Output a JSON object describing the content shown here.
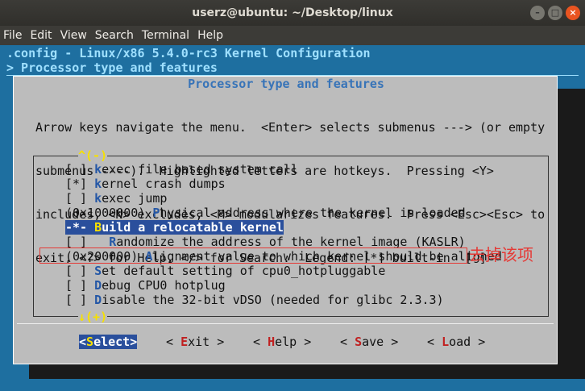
{
  "window": {
    "title": "userz@ubuntu: ~/Desktop/linux"
  },
  "menubar": [
    "File",
    "Edit",
    "View",
    "Search",
    "Terminal",
    "Help"
  ],
  "header": {
    "line1": ".config - Linux/x86 5.4.0-rc3 Kernel Configuration",
    "line2": "> Processor type and features"
  },
  "dialog": {
    "title": "Processor type and features",
    "help": [
      "Arrow keys navigate the menu.  <Enter> selects submenus ---> (or empty",
      "submenus ----).  Highlighted letters are hotkeys.  Pressing <Y>",
      "includes, <N> excludes, <M> modularizes features.  Press <Esc><Esc> to",
      "exit, <?> for Help, </> for Search.  Legend: [*] built-in  [ ]"
    ],
    "scroll_up": "^(-)",
    "scroll_down": "↓(+)",
    "items": [
      {
        "pre": "[ ] ",
        "hot": "k",
        "rest": "exec file based system call"
      },
      {
        "pre": "[*] ",
        "hot": "k",
        "rest": "ernel crash dumps"
      },
      {
        "pre": "[ ] ",
        "hot": "k",
        "rest": "exec jump"
      },
      {
        "pre": "(0x1000000) ",
        "hot": "P",
        "rest": "hysical address where the kernel is loaded"
      },
      {
        "pre": "-*- ",
        "hot": "B",
        "rest": "uild a relocatable kernel"
      },
      {
        "pre": "[ ]   ",
        "hot": "R",
        "rest": "andomize the address of the kernel image (KASLR)"
      },
      {
        "pre": "(0x200000) ",
        "hot": "A",
        "rest": "lignment value to which kernel should be aligned"
      },
      {
        "pre": "[ ] ",
        "hot": "S",
        "rest": "et default setting of cpu0_hotpluggable"
      },
      {
        "pre": "[ ] ",
        "hot": "D",
        "rest": "ebug CPU0 hotplug"
      },
      {
        "pre": "[ ] ",
        "hot": "D",
        "rest": "isable the 32-bit vDSO (needed for glibc 2.3.3)"
      }
    ],
    "buttons": [
      {
        "pre": "<",
        "hot": "S",
        "rest": "elect>"
      },
      {
        "pre": "< ",
        "hot": "E",
        "rest": "xit >"
      },
      {
        "pre": "< ",
        "hot": "H",
        "rest": "elp >"
      },
      {
        "pre": "< ",
        "hot": "S",
        "rest": "ave >"
      },
      {
        "pre": "< ",
        "hot": "L",
        "rest": "oad >"
      }
    ]
  },
  "annotation": "去掉该项"
}
